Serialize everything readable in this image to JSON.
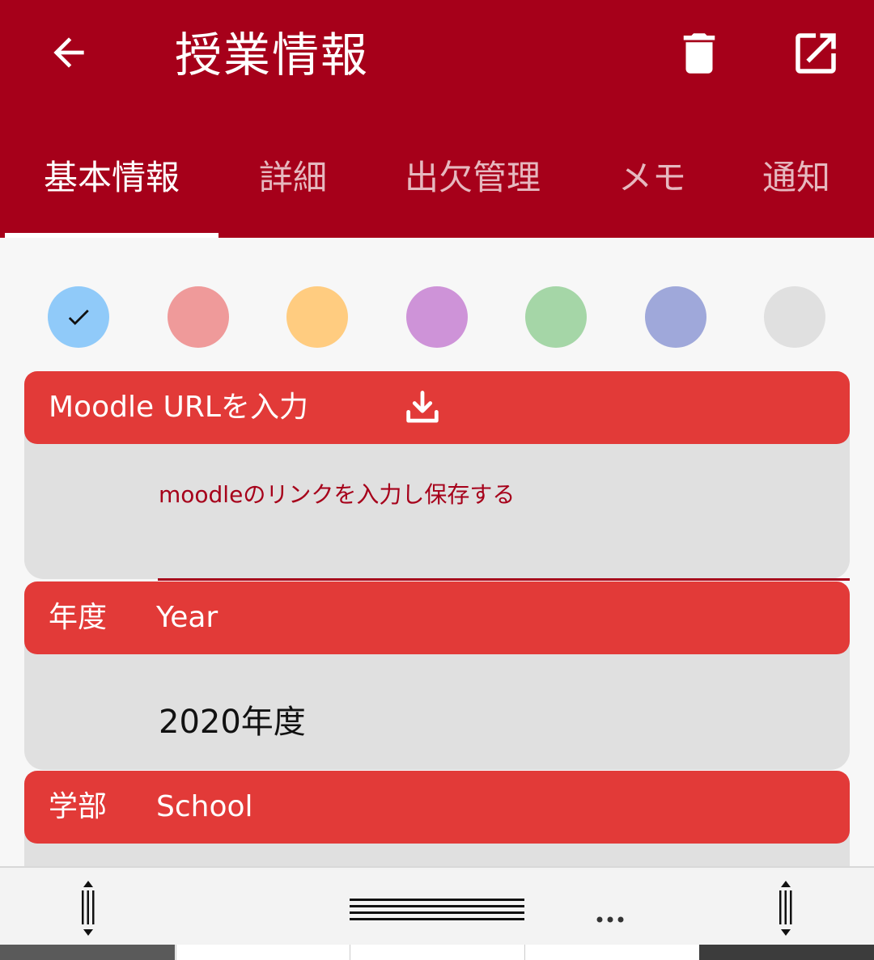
{
  "appbar": {
    "title": "授業情報",
    "back_icon": "arrow-back-icon",
    "delete_icon": "trash-icon",
    "open_icon": "open-external-icon",
    "color": "#a6001a"
  },
  "tabs": [
    {
      "label": "基本情報",
      "active": true
    },
    {
      "label": "詳細"
    },
    {
      "label": "出欠管理"
    },
    {
      "label": "メモ"
    },
    {
      "label": "通知"
    }
  ],
  "colors": {
    "selected_index": 0,
    "swatches": [
      "#90caf9",
      "#ef9a9a",
      "#ffcc80",
      "#ce93d8",
      "#a5d6a7",
      "#9fa8da",
      "#e0e0e0"
    ]
  },
  "moodle": {
    "label": "Moodle URLを入力",
    "download_icon": "download-icon",
    "placeholder": "moodleのリンクを入力し保存する"
  },
  "year": {
    "label": "年度",
    "sublabel": "Year",
    "value": "2020年度"
  },
  "school": {
    "label": "学部",
    "sublabel": "School"
  },
  "bottom_bar": {
    "left_icon": "resize-vertical-icon",
    "center_icon": "drag-handle-icon",
    "more_icon": "more-dots-icon",
    "right_icon": "resize-vertical-icon"
  }
}
